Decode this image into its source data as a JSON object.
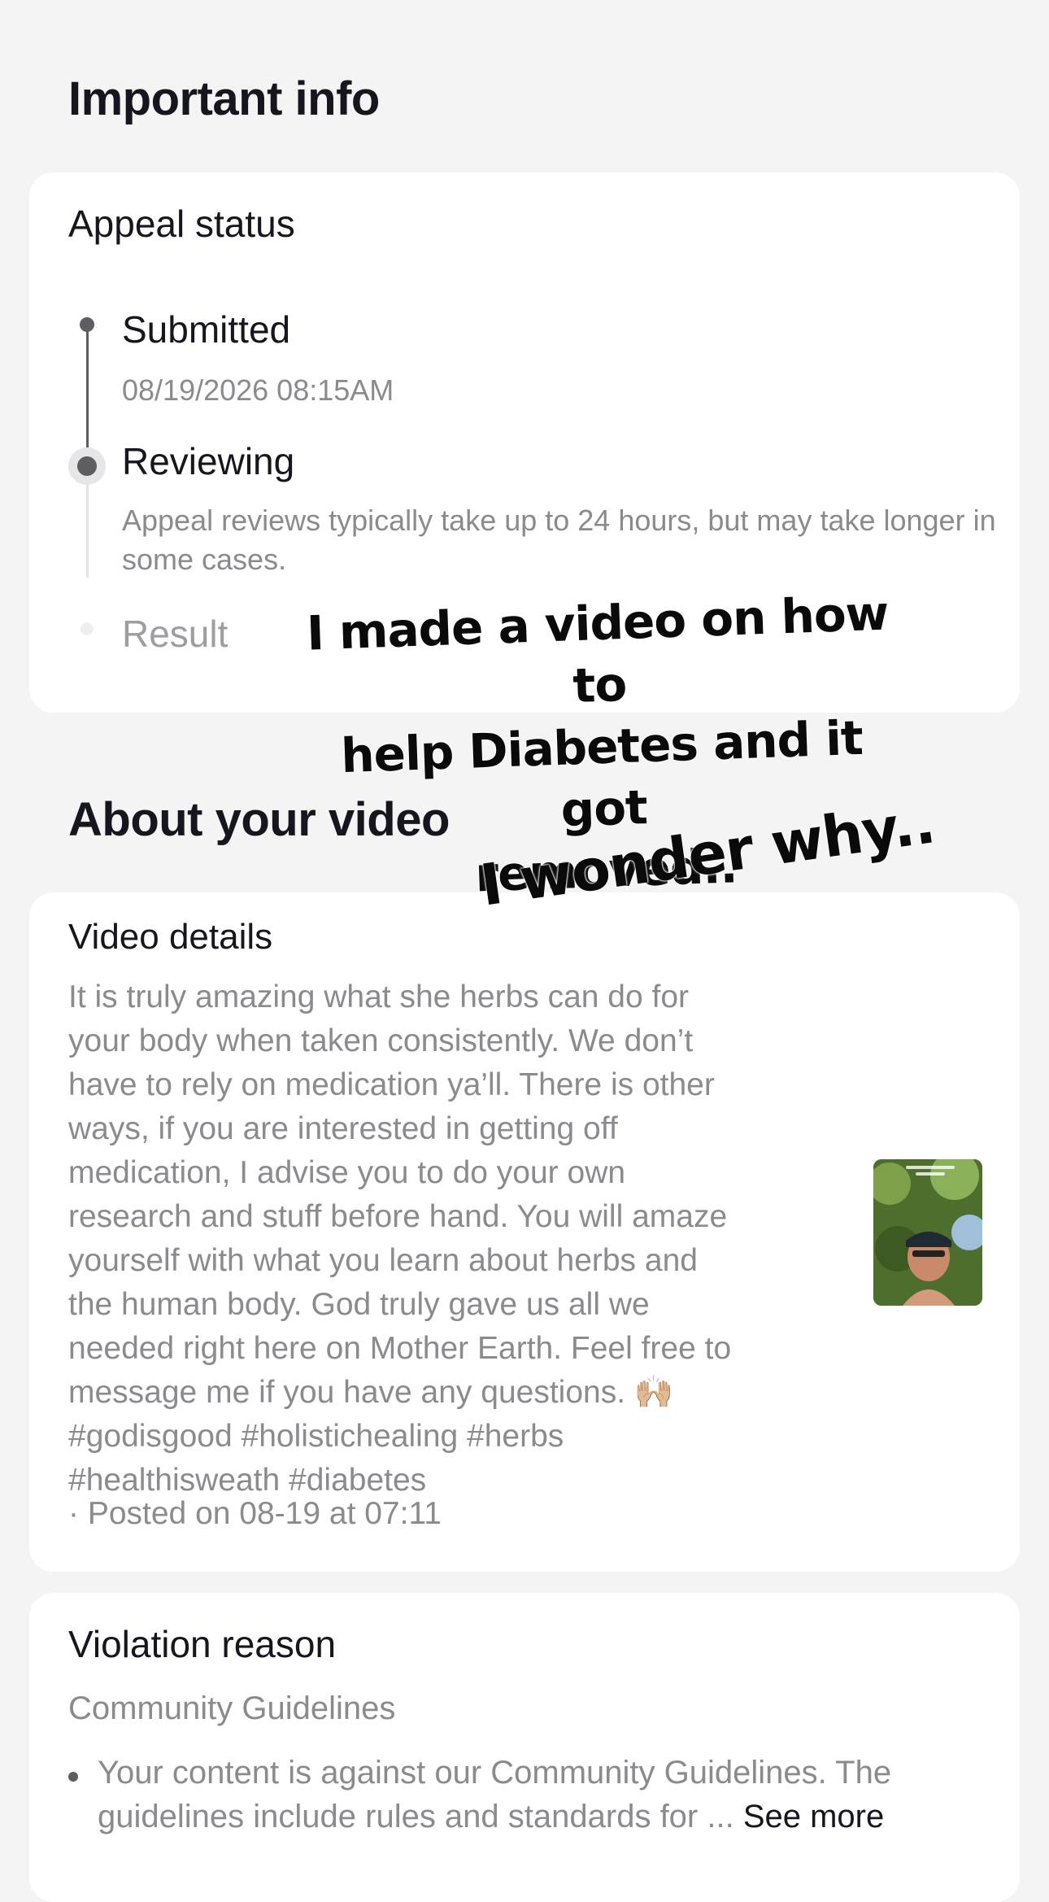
{
  "important_info": {
    "title": "Important info"
  },
  "appeal": {
    "card_title": "Appeal status",
    "steps": [
      {
        "label": "Submitted",
        "detail": "08/19/2026 08:15AM"
      },
      {
        "label": "Reviewing",
        "detail": "Appeal reviews typically take up to 24 hours, but may take longer in some cases."
      },
      {
        "label": "Result",
        "detail": ""
      }
    ]
  },
  "overlay": {
    "line1": "I made a video on how to",
    "line2": "help Diabetes and it got",
    "line3": "removed..",
    "line4": "I wonder why.."
  },
  "about_video": {
    "title": "About your video",
    "card_title": "Video details",
    "description": "It is truly amazing what she herbs can do for\nyour body when taken consistently. We don’t\nhave to rely on medication ya’ll. There is other\nways, if you are interested in getting off\nmedication, I advise you to do your own\nresearch and stuff before hand. You will amaze\nyourself with what you learn about herbs and\nthe human body. God truly gave us all we\nneeded right here on Mother Earth. Feel free to\nmessage me if you have any questions. 🙌🏼\n#godisgood #holistichealing #herbs\n#healthisweath #diabetes",
    "posted": "· Posted on 08-19 at 07:11"
  },
  "violation": {
    "card_title": "Violation reason",
    "category": "Community Guidelines",
    "bullet_text": "Your content is against our Community Guidelines. The guidelines include rules and standards for ... ",
    "see_more": "See more"
  },
  "colors": {
    "background": "#f4f4f5",
    "card": "#ffffff",
    "primary_text": "#16161e",
    "secondary_text": "#8a8a8f",
    "muted_text": "#9d9da2",
    "timeline_active": "#5e5e62"
  }
}
